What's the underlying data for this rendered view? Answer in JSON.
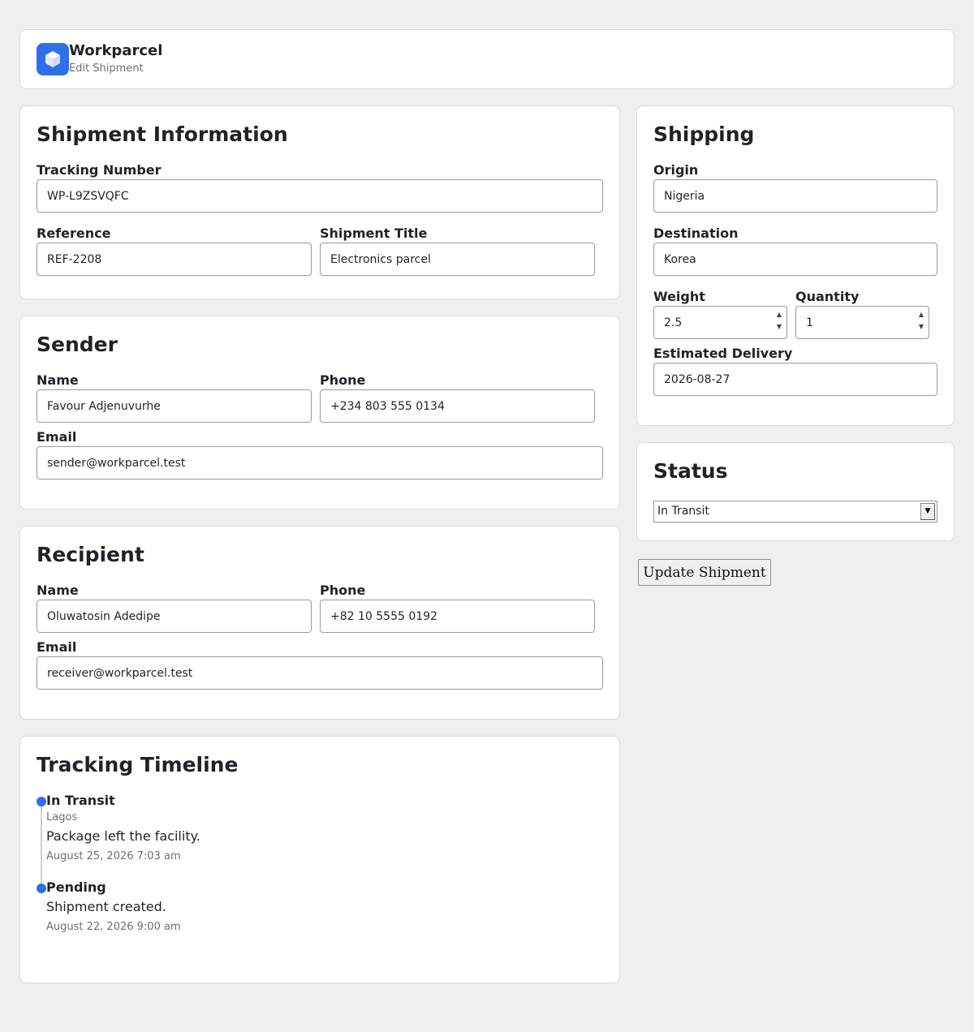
{
  "header": {
    "brand": "Workparcel",
    "subtitle": "Edit Shipment"
  },
  "shipment_info": {
    "title": "Shipment Information",
    "tracking_label": "Tracking Number",
    "tracking_value": "WP-L9ZSVQFC",
    "reference_label": "Reference",
    "reference_value": "REF-2208",
    "shipment_title_label": "Shipment Title",
    "shipment_title_value": "Electronics parcel"
  },
  "sender": {
    "title": "Sender",
    "name_label": "Name",
    "name_value": "Favour Adjenuvurhe",
    "phone_label": "Phone",
    "phone_value": "+234 803 555 0134",
    "email_label": "Email",
    "email_value": "sender@workparcel.test"
  },
  "recipient": {
    "title": "Recipient",
    "name_label": "Name",
    "name_value": "Oluwatosin Adedipe",
    "phone_label": "Phone",
    "phone_value": "+82 10 5555 0192",
    "email_label": "Email",
    "email_value": "receiver@workparcel.test"
  },
  "timeline": {
    "title": "Tracking Timeline",
    "events": [
      {
        "status": "In Transit",
        "location": "Lagos",
        "message": "Package left the facility.",
        "time": "August 25, 2026 7:03 am"
      },
      {
        "status": "Pending",
        "message": "Shipment created.",
        "time": "August 22, 2026 9:00 am"
      }
    ]
  },
  "shipping": {
    "title": "Shipping",
    "origin_label": "Origin",
    "origin_value": "Nigeria",
    "destination_label": "Destination",
    "destination_value": "Korea",
    "weight_label": "Weight",
    "weight_value": "2.5",
    "quantity_label": "Quantity",
    "quantity_value": "1",
    "delivery_label": "Estimated Delivery",
    "delivery_value": "2026-08-27"
  },
  "status": {
    "title": "Status",
    "selected": "In Transit"
  },
  "actions": {
    "update_label": "Update Shipment"
  },
  "colors": {
    "accent": "#2f6fe8",
    "background": "#efefef"
  },
  "icons": {
    "logo": "package-box-icon",
    "select_arrow": "chevron-down-icon"
  }
}
